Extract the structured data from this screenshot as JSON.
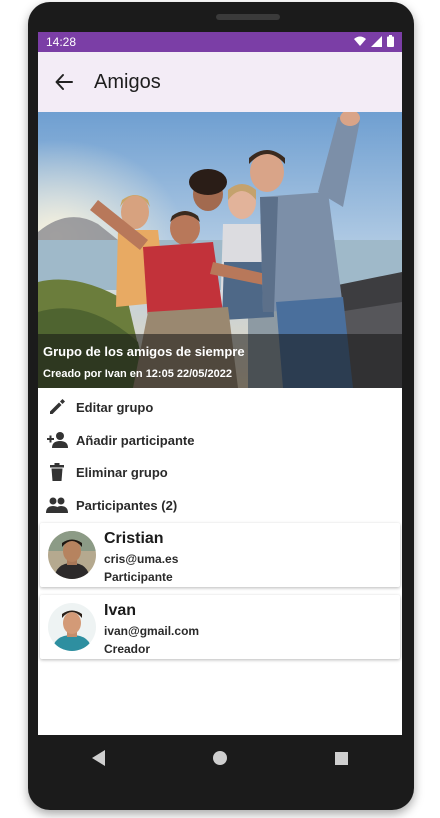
{
  "status_bar": {
    "time": "14:28"
  },
  "app_bar": {
    "title": "Amigos"
  },
  "group": {
    "name": "Grupo de los amigos de siempre",
    "created": "Creado por Ivan en 12:05 22/05/2022"
  },
  "actions": [
    {
      "label": "Editar grupo",
      "icon": "pencil-icon"
    },
    {
      "label": "Añadir participante",
      "icon": "person-add-icon"
    },
    {
      "label": "Eliminar grupo",
      "icon": "trash-icon"
    },
    {
      "label": "Participantes (2)",
      "icon": "group-icon"
    }
  ],
  "participants": [
    {
      "name": "Cristian",
      "email": "cris@uma.es",
      "role": "Participante"
    },
    {
      "name": "Ivan",
      "email": "ivan@gmail.com",
      "role": "Creador"
    }
  ],
  "colors": {
    "status_bar": "#7b3ea6",
    "app_bar": "#f3ecf6"
  }
}
